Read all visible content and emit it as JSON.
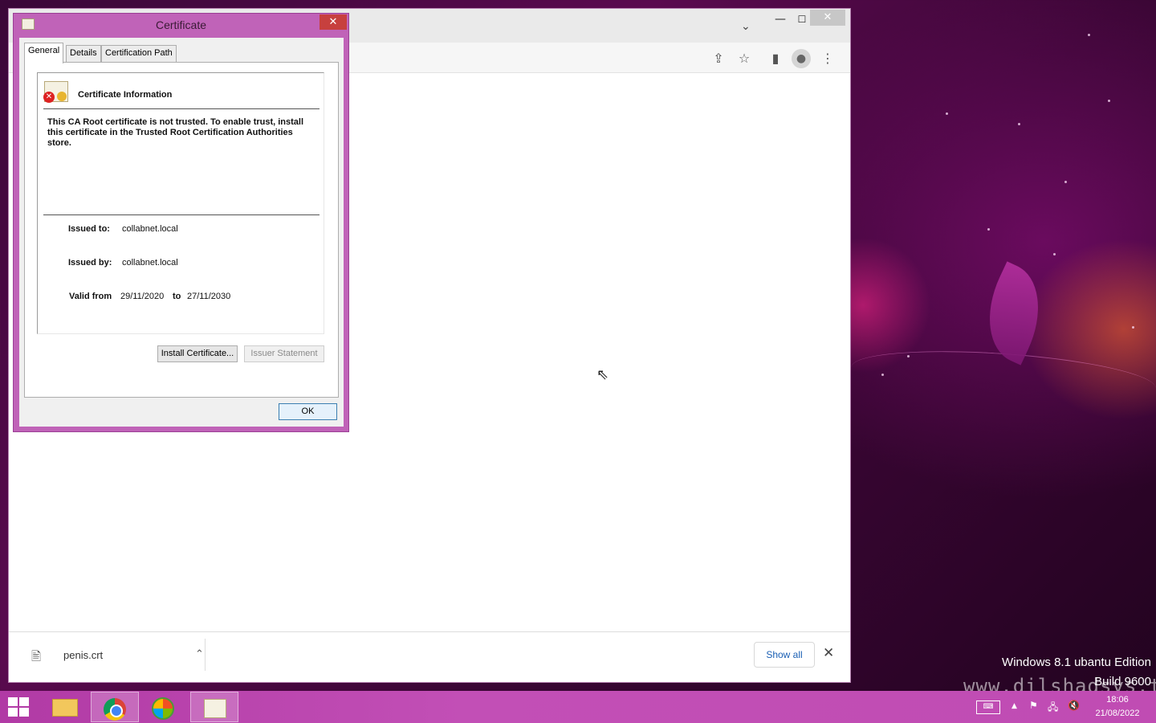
{
  "colors": {
    "dialog_frame": "#c063b8",
    "dialog_close": "#c7403e",
    "taskbar": "#b13aa5",
    "link_blue": "#1a5fb4"
  },
  "certificate_dialog": {
    "title": "Certificate",
    "close_glyph": "✕",
    "tabs": [
      {
        "label": "General",
        "active": true
      },
      {
        "label": "Details",
        "active": false
      },
      {
        "label": "Certification Path",
        "active": false
      }
    ],
    "info_title": "Certificate Information",
    "message": "This CA Root certificate is not trusted. To enable trust, install this certificate in the Trusted Root Certification Authorities store.",
    "issued_to_label": "Issued to:",
    "issued_to": "collabnet.local",
    "issued_by_label": "Issued by:",
    "issued_by": "collabnet.local",
    "valid_from_label": "Valid from",
    "valid_from": "29/11/2020",
    "to_label": "to",
    "valid_to": "27/11/2030",
    "install_button": "Install Certificate...",
    "issuer_statement_button": "Issuer Statement",
    "ok_button": "OK"
  },
  "browser": {
    "tab_search_glyph": "⌄",
    "minimize_glyph": "—",
    "maximize_glyph": "☐",
    "close_glyph": "✕",
    "toolbar_icons": [
      "share-icon",
      "star-icon",
      "side-panel-icon",
      "profile-icon",
      "more-icon"
    ],
    "share_glyph": "⇪",
    "star_glyph": "☆",
    "sidepanel_glyph": "▮",
    "profile_glyph": "●",
    "more_glyph": "⋮",
    "download": {
      "filename": "penis.crt",
      "chevron_glyph": "⌃",
      "show_all": "Show all",
      "close_glyph": "✕"
    }
  },
  "taskbar": {
    "apps": [
      "file-explorer",
      "google-chrome",
      "windows-media",
      "certificate"
    ],
    "tray_up_glyph": "▲",
    "flag_glyph": "⚑",
    "network_glyph": "🖧",
    "volume_glyph": "🔇",
    "keyboard_glyph": "⌨",
    "clock_time": "18:06",
    "clock_date": "21/08/2022"
  },
  "watermark": {
    "edition": "Windows 8.1 ubantu Edition",
    "build": "Build 9600",
    "site": "www.dilshadsys.tk"
  }
}
